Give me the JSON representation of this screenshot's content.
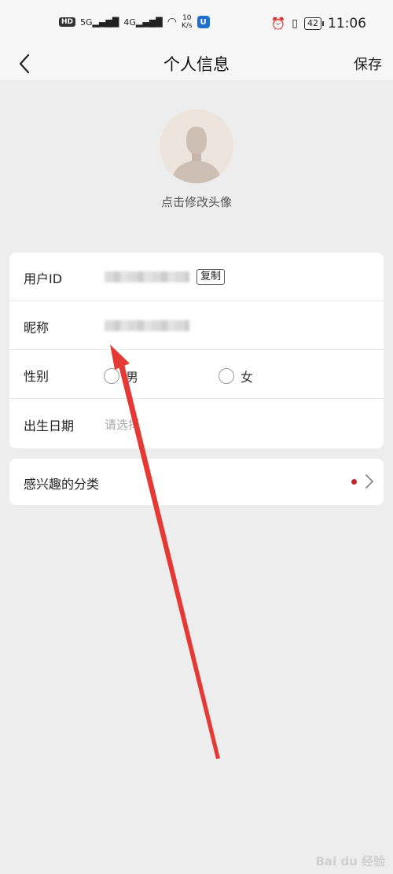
{
  "status_bar": {
    "hd": "HD",
    "net_5g": "5G",
    "net_4g": "4G",
    "speed_value": "10",
    "speed_unit": "K/s",
    "battery": "42",
    "time": "11:06"
  },
  "nav": {
    "title": "个人信息",
    "save_label": "保存"
  },
  "avatar": {
    "hint": "点击修改头像"
  },
  "info": {
    "user_id_label": "用户ID",
    "copy_label": "复制",
    "nickname_label": "昵称",
    "gender_label": "性别",
    "gender_options": [
      "男",
      "女"
    ],
    "birthday_label": "出生日期",
    "birthday_placeholder": "请选择"
  },
  "interest": {
    "label": "感兴趣的分类"
  },
  "watermark": "Bai du 经验",
  "colors": {
    "accent_red": "#c9252d",
    "page_bg": "#ededed",
    "arrow": "#e53935"
  }
}
